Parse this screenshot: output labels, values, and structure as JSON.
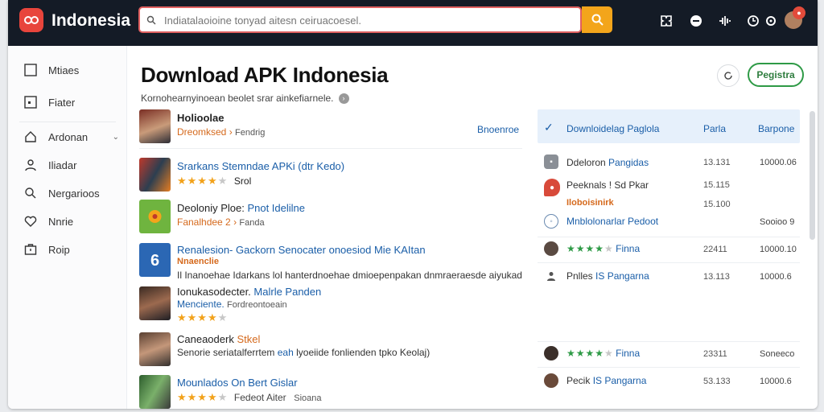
{
  "header": {
    "logo_text": "Indonesia",
    "search_placeholder": "Indiatalaoioine tonyad aitesn ceiruacoesel.",
    "colors": {
      "topbar": "#141b26",
      "search_button": "#f3a51b",
      "accent": "#2e9a46"
    }
  },
  "sidebar": {
    "items": [
      {
        "label": "Mtiaes",
        "icon": "square-icon"
      },
      {
        "label": "Fiater",
        "icon": "square-dot-icon"
      },
      {
        "label": "Ardonan",
        "icon": "home-icon"
      },
      {
        "label": "Iliadar",
        "icon": "user-icon"
      },
      {
        "label": "Nergarioos",
        "icon": "search-icon"
      },
      {
        "label": "Nnrie",
        "icon": "heart-icon"
      },
      {
        "label": "Roip",
        "icon": "briefcase-icon"
      }
    ]
  },
  "main": {
    "title": "Download APK Indonesia",
    "subtitle": "Kornohearnyinoean beolet srar ainkefiarnele.",
    "register_label": "Pegistra",
    "featured": {
      "title": "Holioolae",
      "meta_orange": "Dreomksed",
      "meta_rest": "Fendrig",
      "link": "Bnoenroe"
    },
    "apps": [
      {
        "title": "Srarkans Stemndae APKi (dtr Kedo)",
        "rating": "★★★★",
        "rating_empty": "★",
        "extra": "Srol"
      },
      {
        "title_dark": "Deoloniy Ploe:",
        "title_blue": "Pnot Idelilne",
        "meta_orange": "Fanalhdee 2",
        "meta_rest": "Fanda"
      },
      {
        "title": "Renalesion- Gackorn Senocater onoesiod Mie KAItan",
        "meta_orange": "Nnaenclie",
        "desc": "Il Inanoehae Idarkans lol hanterdnoehae dmioepenpakan dnmraeraesde aiyukad"
      },
      {
        "title_dark": "Ionukasodecter.",
        "title_blue": "Malrle Panden",
        "meta_blue": "Menciente.",
        "meta_rest": "Fordreontoeain",
        "rating": "★★★★",
        "rating_empty": "★"
      },
      {
        "title_dark": "Caneaoderk",
        "title_orange": "Stkel",
        "desc_dark": "Senorie seriatalferrtem",
        "desc_blue": "eah",
        "desc_rest": "lyoeiide fonlienden tpko Keolaj)"
      },
      {
        "title_blue": "Mounlados",
        "title_dark": "On Bert Gislar",
        "rating": "★★★★",
        "rating_empty": "★",
        "extra": "Fedeot Aiter",
        "extra2": "Sioana"
      }
    ]
  },
  "right_panel": {
    "header": {
      "title": "Downloidelag Paglola",
      "col1": "Parla",
      "col2": "Barpone"
    },
    "rows": [
      {
        "label_dark": "Ddeloron",
        "label_blue": "Pangidas",
        "num": "13.131",
        "num2": "10000.06"
      },
      {
        "label": "Peeknals ! Sd Pkar",
        "num": "15.115"
      },
      {
        "rating": "Iloboisinirk",
        "num": "15.100"
      },
      {
        "label": "Mnblolonarlar Pedoot",
        "num2": "Sooioo 9"
      },
      {
        "rating": "★★★★",
        "rating_empty": "★",
        "label": "Finna",
        "num": "22411",
        "num2": "10000.10"
      },
      {
        "label_dark": "Pnlles",
        "label_blue": "IS Pangarna",
        "num": "13.113",
        "num2": "10000.6"
      },
      {
        "rating": "★★★★",
        "rating_empty": "★",
        "label": "Finna",
        "num": "23311",
        "num2": "Soneeco"
      },
      {
        "label_dark": "Pecik",
        "label_blue": "IS Pangarna",
        "num": "53.133",
        "num2": "10000.6"
      }
    ]
  }
}
